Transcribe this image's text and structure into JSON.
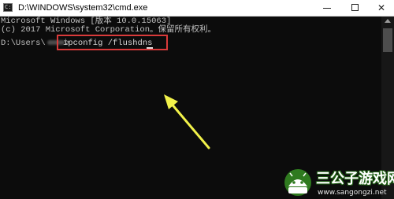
{
  "window": {
    "title": "D:\\WINDOWS\\system32\\cmd.exe",
    "icon": "cmd-icon",
    "controls": {
      "minimize_icon": "minimize-icon",
      "maximize_icon": "maximize-icon",
      "close_label": "✕"
    }
  },
  "console": {
    "line1": "Microsoft Windows [版本 10.0.15063]",
    "line2": "(c) 2017 Microsoft Corporation。保留所有权利。",
    "prompt_prefix": "D:\\Users\\",
    "prompt_suffix": ">",
    "command": "ipconfig /flushdns"
  },
  "annotation": {
    "highlight_color": "#d93a3a",
    "arrow_color": "#f2f24a"
  },
  "watermark": {
    "title": "三公子游戏网",
    "url": "www.sangongzi.net"
  }
}
